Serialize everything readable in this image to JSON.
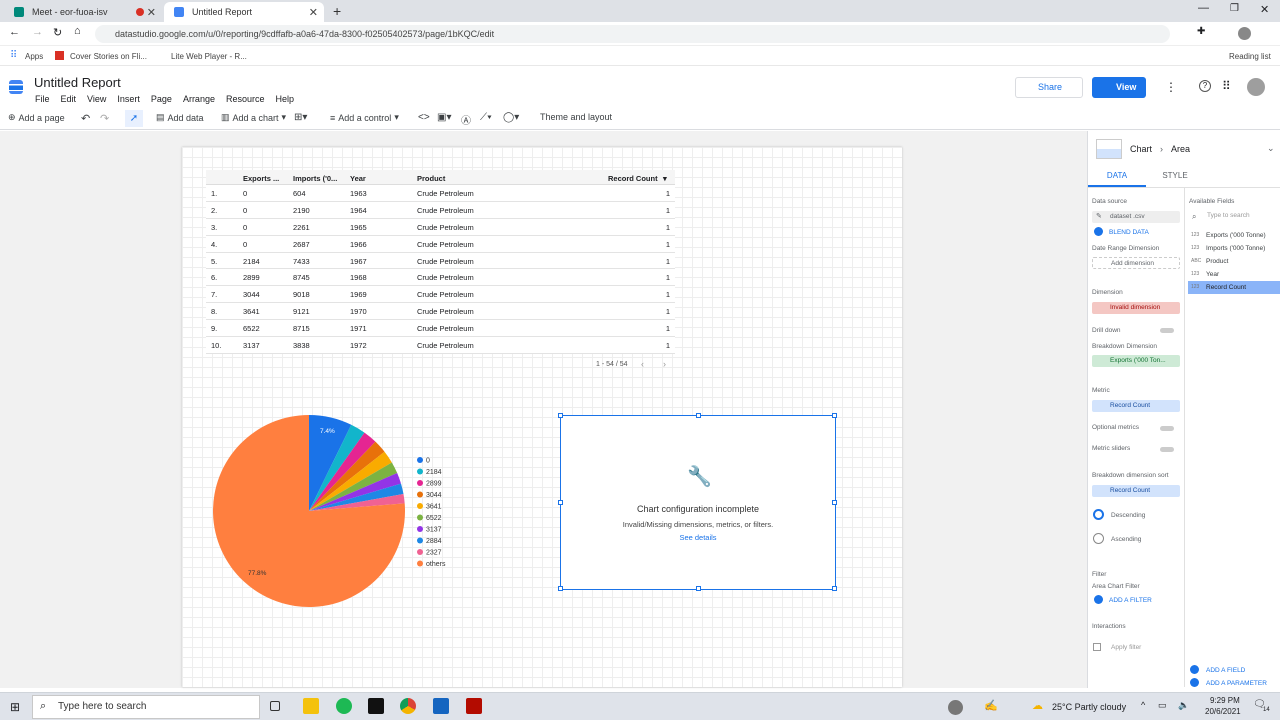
{
  "browser": {
    "tabs": [
      {
        "label": "Meet - eor-fuoa-isv",
        "active": false
      },
      {
        "label": "Untitled Report",
        "active": true
      }
    ],
    "url": "datastudio.google.com/u/0/reporting/9cdffafb-a0a6-47da-8300-f02505402573/page/1bKQC/edit",
    "bookmarks": [
      "Apps",
      "Cover Stories on Fli...",
      "Lite Web Player - R..."
    ],
    "reading_list": "Reading list"
  },
  "app": {
    "title": "Untitled Report",
    "menus": [
      "File",
      "Edit",
      "View",
      "Insert",
      "Page",
      "Arrange",
      "Resource",
      "Help"
    ],
    "share_label": "Share",
    "view_label": "View"
  },
  "toolbar": {
    "add_page": "Add a page",
    "add_data": "Add data",
    "add_chart": "Add a chart",
    "add_control": "Add a control",
    "theme": "Theme and layout"
  },
  "table": {
    "headers": [
      "Exports ...",
      "Imports ('0...",
      "Year",
      "Product",
      "Record Count"
    ],
    "rows": [
      [
        "1.",
        "0",
        "604",
        "1963",
        "Crude Petroleum",
        "1"
      ],
      [
        "2.",
        "0",
        "2190",
        "1964",
        "Crude Petroleum",
        "1"
      ],
      [
        "3.",
        "0",
        "2261",
        "1965",
        "Crude Petroleum",
        "1"
      ],
      [
        "4.",
        "0",
        "2687",
        "1966",
        "Crude Petroleum",
        "1"
      ],
      [
        "5.",
        "2184",
        "7433",
        "1967",
        "Crude Petroleum",
        "1"
      ],
      [
        "6.",
        "2899",
        "8745",
        "1968",
        "Crude Petroleum",
        "1"
      ],
      [
        "7.",
        "3044",
        "9018",
        "1969",
        "Crude Petroleum",
        "1"
      ],
      [
        "8.",
        "3641",
        "9121",
        "1970",
        "Crude Petroleum",
        "1"
      ],
      [
        "9.",
        "6522",
        "8715",
        "1971",
        "Crude Petroleum",
        "1"
      ],
      [
        "10.",
        "3137",
        "3838",
        "1972",
        "Crude Petroleum",
        "1"
      ]
    ],
    "pagination": "1 - 54 / 54"
  },
  "pie": {
    "labels": [
      "0",
      "2184",
      "2899",
      "3044",
      "3641",
      "6522",
      "3137",
      "2884",
      "2327",
      "others"
    ],
    "values": [
      7.4,
      2.6,
      2.4,
      2.3,
      2.2,
      2.0,
      1.9,
      1.8,
      1.6,
      77.8
    ],
    "colors": [
      "#1a73e8",
      "#12b5cb",
      "#e52592",
      "#e8710a",
      "#f9ab00",
      "#7cb342",
      "#9334e6",
      "#1e88e5",
      "#f06292",
      "#ff7f3f"
    ],
    "slice_label_first": "7.4%",
    "slice_label_last": "77.8%"
  },
  "error_card": {
    "title": "Chart configuration incomplete",
    "message": "Invalid/Missing dimensions, metrics, or filters.",
    "link": "See details"
  },
  "panel": {
    "chart_path": "Chart",
    "chart_type": "Area",
    "tab_data": "DATA",
    "tab_style": "STYLE",
    "data_source_label": "Data source",
    "data_source": "dataset .csv",
    "blend": "BLEND DATA",
    "date_range": "Date Range Dimension",
    "add_dimension": "Add dimension",
    "dimension_label": "Dimension",
    "invalid_dimension": "Invalid dimension",
    "drill_down": "Drill down",
    "breakdown_label": "Breakdown Dimension",
    "breakdown_field": "Exports ('000 Ton...",
    "metric_label": "Metric",
    "metric_field": "Record Count",
    "optional_metrics": "Optional metrics",
    "metric_sliders": "Metric sliders",
    "sort_label": "Breakdown dimension sort",
    "sort_field": "Record Count",
    "descending": "Descending",
    "ascending": "Ascending",
    "filter_label": "Filter",
    "area_filter": "Area Chart Filter",
    "add_filter": "ADD A FILTER",
    "interactions": "Interactions",
    "apply_filter": "Apply filter",
    "available_fields": "Available Fields",
    "search_placeholder": "Type to search",
    "fields": [
      "Exports ('000 Tonne)",
      "Imports ('000 Tonne)",
      "Product",
      "Year",
      "Record Count"
    ],
    "add_field": "ADD A FIELD",
    "add_parameter": "ADD A PARAMETER"
  },
  "taskbar": {
    "search": "Type here to search",
    "weather": "25°C  Partly cloudy",
    "time": "9:29 PM",
    "date": "20/6/2021",
    "notifications": "14"
  }
}
